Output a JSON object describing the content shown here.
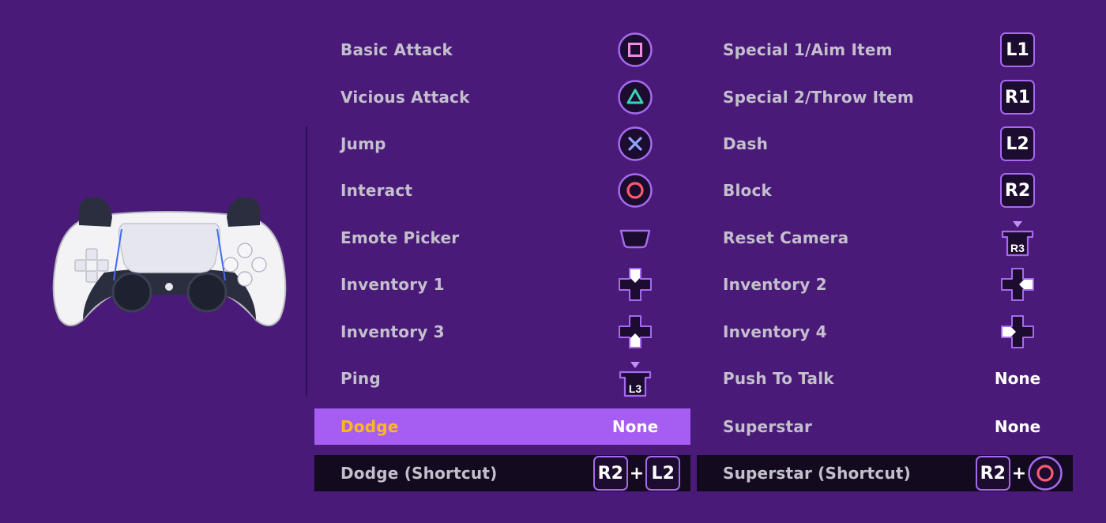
{
  "left_column": [
    {
      "label": "Basic Attack",
      "button": "square-icon"
    },
    {
      "label": "Vicious Attack",
      "button": "triangle-icon"
    },
    {
      "label": "Jump",
      "button": "cross-icon"
    },
    {
      "label": "Interact",
      "button": "circle-icon"
    },
    {
      "label": "Emote Picker",
      "button": "touchpad-icon"
    },
    {
      "label": "Inventory 1",
      "button": "dpad-up-icon"
    },
    {
      "label": "Inventory 3",
      "button": "dpad-down-icon"
    },
    {
      "label": "Ping",
      "button": "l3-icon",
      "button_text": "L3"
    },
    {
      "label": "Dodge",
      "value": "None"
    },
    {
      "label": "Dodge (Shortcut)",
      "keys": [
        "R2",
        "L2"
      ],
      "plus": "+"
    }
  ],
  "right_column": [
    {
      "label": "Special 1/Aim Item",
      "key": "L1"
    },
    {
      "label": "Special 2/Throw Item",
      "key": "R1"
    },
    {
      "label": "Dash",
      "key": "L2"
    },
    {
      "label": "Block",
      "key": "R2"
    },
    {
      "label": "Reset Camera",
      "button": "r3-icon",
      "button_text": "R3"
    },
    {
      "label": "Inventory 2",
      "button": "dpad-right-icon"
    },
    {
      "label": "Inventory 4",
      "button": "dpad-left-icon"
    },
    {
      "label": "Push To Talk",
      "value": "None"
    },
    {
      "label": "Superstar",
      "value": "None"
    },
    {
      "label": "Superstar (Shortcut)",
      "keys": [
        "R2"
      ],
      "plus": "+",
      "button": "circle-icon"
    }
  ],
  "selected_row": "Dodge",
  "colors": {
    "background": "#4a1a78",
    "selected_row": "#a65ef2",
    "selected_label": "#ffb81c",
    "shortcut_row": "#140a1f",
    "button_border": "#a66af0",
    "square": "#f08ce0",
    "triangle": "#38d6b4",
    "cross": "#8fa6ff",
    "circle": "#ff5a6e"
  }
}
